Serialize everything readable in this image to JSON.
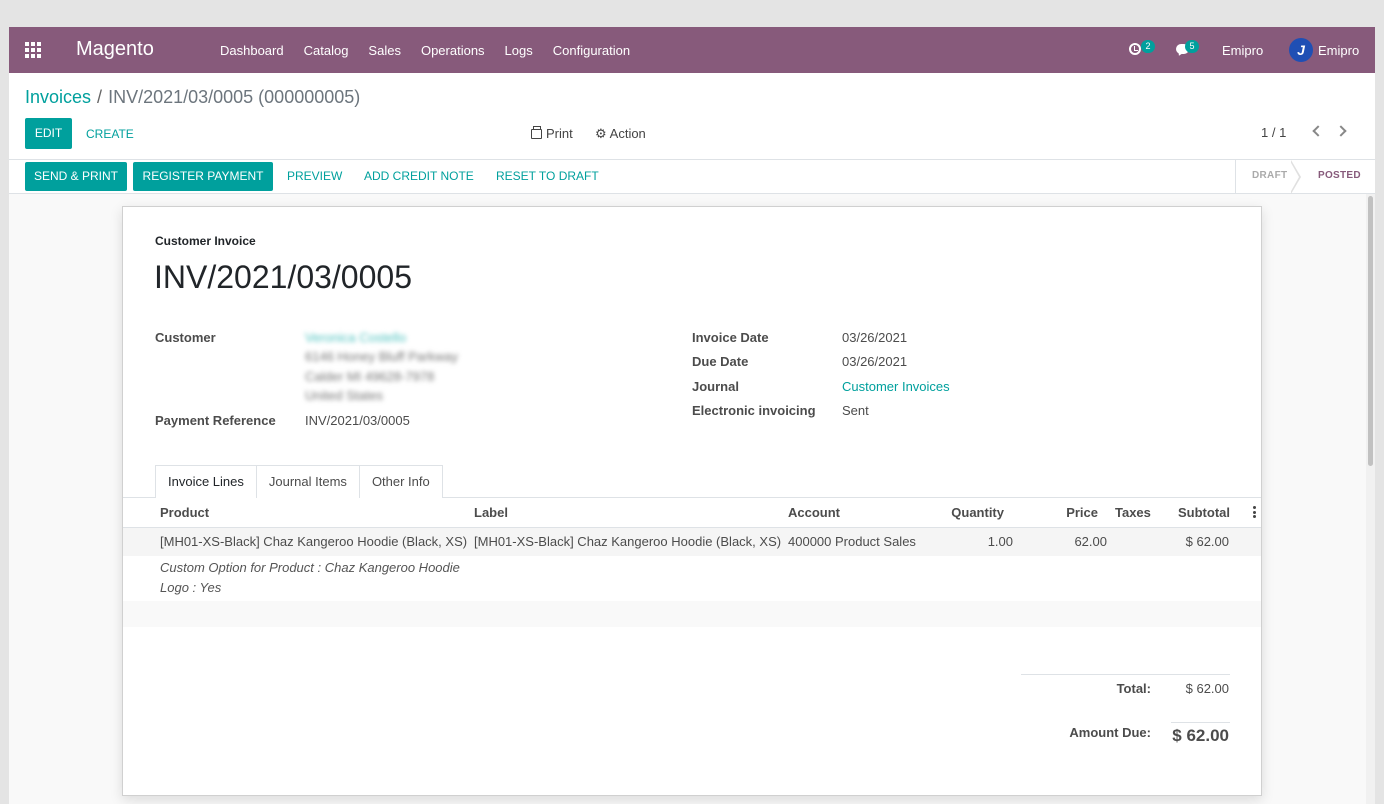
{
  "navbar": {
    "brand": "Magento",
    "menu": [
      "Dashboard",
      "Catalog",
      "Sales",
      "Operations",
      "Logs",
      "Configuration"
    ],
    "activity_count": "2",
    "message_count": "5",
    "company": "Emipro",
    "user_name": "Emipro",
    "avatar_letter": "J",
    "accent_color": "#875a7b"
  },
  "breadcrumb": {
    "parent": "Invoices",
    "separator": "/",
    "current": "INV/2021/03/0005 (000000005)"
  },
  "controls": {
    "edit": "EDIT",
    "create": "CREATE",
    "print": "Print",
    "action": "Action",
    "pager": "1 / 1"
  },
  "statusbar": {
    "buttons": [
      "SEND & PRINT",
      "REGISTER PAYMENT",
      "PREVIEW",
      "ADD CREDIT NOTE",
      "RESET TO DRAFT"
    ],
    "stages": [
      "DRAFT",
      "POSTED"
    ],
    "current_stage": "POSTED"
  },
  "invoice": {
    "type_label": "Customer Invoice",
    "number": "INV/2021/03/0005",
    "customer_label": "Customer",
    "customer_name": "Veronica Costello",
    "customer_address": [
      "6146 Honey Bluff Parkway",
      "Calder MI 49628-7978",
      "United States"
    ],
    "payment_ref_label": "Payment Reference",
    "payment_ref": "INV/2021/03/0005",
    "invoice_date_label": "Invoice Date",
    "invoice_date": "03/26/2021",
    "due_date_label": "Due Date",
    "due_date": "03/26/2021",
    "journal_label": "Journal",
    "journal": "Customer Invoices",
    "edi_label": "Electronic invoicing",
    "edi": "Sent"
  },
  "tabs": [
    "Invoice Lines",
    "Journal Items",
    "Other Info"
  ],
  "active_tab": "Invoice Lines",
  "lines": {
    "columns": [
      "Product",
      "Label",
      "Account",
      "Quantity",
      "Price",
      "Taxes",
      "Subtotal"
    ],
    "rows": [
      {
        "product": "[MH01-XS-Black] Chaz Kangeroo Hoodie (Black, XS)",
        "label": "[MH01-XS-Black] Chaz Kangeroo Hoodie (Black, XS)",
        "account": "400000 Product Sales",
        "quantity": "1.00",
        "price": "62.00",
        "taxes": "",
        "subtotal": "$ 62.00"
      }
    ],
    "notes": [
      "Custom Option for Product : Chaz Kangeroo Hoodie",
      "Logo : Yes"
    ]
  },
  "totals": {
    "total_label": "Total:",
    "total": "$ 62.00",
    "amount_due_label": "Amount Due:",
    "amount_due": "$ 62.00"
  }
}
